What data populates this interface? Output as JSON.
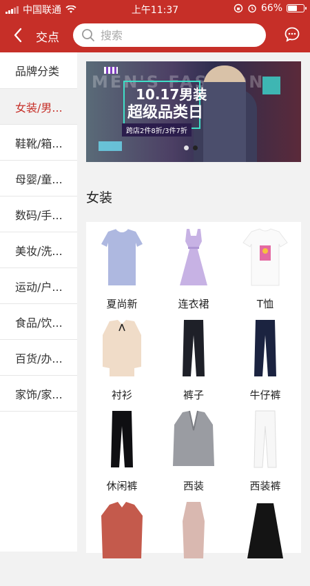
{
  "status_bar": {
    "carrier": "中国联通",
    "time": "上午11:37",
    "battery": "66%",
    "battery_level": 0.66
  },
  "header": {
    "back_label": "交点",
    "search_placeholder": "搜索"
  },
  "sidebar": {
    "items": [
      {
        "label": "品牌分类"
      },
      {
        "label": "女装/男..."
      },
      {
        "label": "鞋靴/箱..."
      },
      {
        "label": "母婴/童..."
      },
      {
        "label": "数码/手..."
      },
      {
        "label": "美妆/洗..."
      },
      {
        "label": "运动/户..."
      },
      {
        "label": "食品/饮..."
      },
      {
        "label": "百货/办..."
      },
      {
        "label": "家饰/家..."
      }
    ],
    "active_index": 1
  },
  "banner": {
    "ghost_text": "MEN'S FASHION",
    "line1": "10.17男装",
    "line2": "超级品类日",
    "line3": "跨店2件8折/3件7折",
    "slide_count": 2,
    "current_slide": 1
  },
  "section": {
    "title": "女装"
  },
  "categories": [
    {
      "label": "夏尚新"
    },
    {
      "label": "连衣裙"
    },
    {
      "label": "T恤"
    },
    {
      "label": "衬衫"
    },
    {
      "label": "裤子"
    },
    {
      "label": "牛仔裤"
    },
    {
      "label": "休闲裤"
    },
    {
      "label": "西装"
    },
    {
      "label": "西装裤"
    },
    {
      "label": ""
    },
    {
      "label": ""
    },
    {
      "label": ""
    }
  ],
  "colors": {
    "brand": "#c62f28",
    "active_text": "#c62f28"
  }
}
